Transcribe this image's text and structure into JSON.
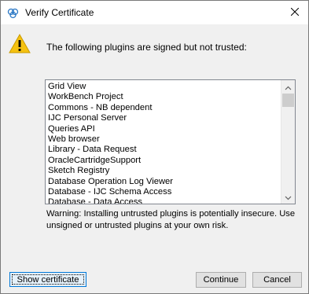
{
  "window": {
    "title": "Verify Certificate",
    "close_glyph": "✕"
  },
  "header": {
    "message": "The following plugins are signed but not trusted:"
  },
  "plugins": {
    "items": [
      "Grid View",
      "WorkBench Project",
      "Commons - NB dependent",
      "IJC Personal Server",
      "Queries API",
      "Web browser",
      "Library - Data Request",
      "OracleCartridgeSupport",
      "Sketch Registry",
      "Database Operation Log Viewer",
      "Database - IJC Schema Access",
      "Database - Data Access"
    ],
    "scroll_up_glyph": "⌃",
    "scroll_down_glyph": "⌄"
  },
  "warning": {
    "text": "Warning: Installing untrusted plugins is potentially insecure. Use unsigned or untrusted plugins at your own risk."
  },
  "buttons": {
    "show_certificate": "Show certificate",
    "continue": "Continue",
    "cancel": "Cancel"
  },
  "icons": {
    "title": "certificate-icon",
    "warning": "warning-icon",
    "warning_color": "#f5c211",
    "accent": "#0078d7"
  }
}
